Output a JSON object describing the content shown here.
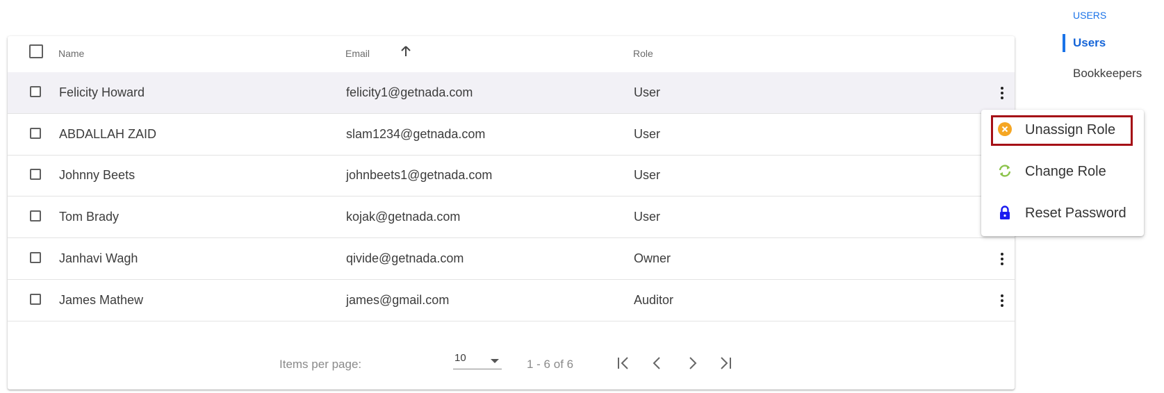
{
  "table": {
    "headers": {
      "name": "Name",
      "email": "Email",
      "role": "Role"
    },
    "rows": [
      {
        "name": "Felicity Howard",
        "email": "felicity1@getnada.com",
        "role": "User"
      },
      {
        "name": "ABDALLAH ZAID",
        "email": "slam1234@getnada.com",
        "role": "User"
      },
      {
        "name": "Johnny Beets",
        "email": "johnbeets1@getnada.com",
        "role": "User"
      },
      {
        "name": "Tom Brady",
        "email": "kojak@getnada.com",
        "role": "User"
      },
      {
        "name": "Janhavi Wagh",
        "email": "qivide@getnada.com",
        "role": "Owner"
      },
      {
        "name": "James Mathew",
        "email": "james@gmail.com",
        "role": "Auditor"
      }
    ]
  },
  "paginator": {
    "items_per_page_label": "Items per page:",
    "page_size": "10",
    "range_label": "1 - 6 of 6"
  },
  "sidebar": {
    "heading": "USERS",
    "items": [
      {
        "label": "Users",
        "active": true
      },
      {
        "label": "Bookkeepers",
        "active": false
      }
    ]
  },
  "context_menu": {
    "items": [
      {
        "label": "Unassign Role",
        "icon": "cancel-circle-icon",
        "color": "#f5a623"
      },
      {
        "label": "Change Role",
        "icon": "sync-icon",
        "color": "#8bc34a"
      },
      {
        "label": "Reset Password",
        "icon": "lock-icon",
        "color": "#1a1af0"
      }
    ]
  },
  "colors": {
    "accent": "#1a73e8",
    "highlight_box": "#a50f16",
    "row_highlight": "#f2f1f6"
  }
}
